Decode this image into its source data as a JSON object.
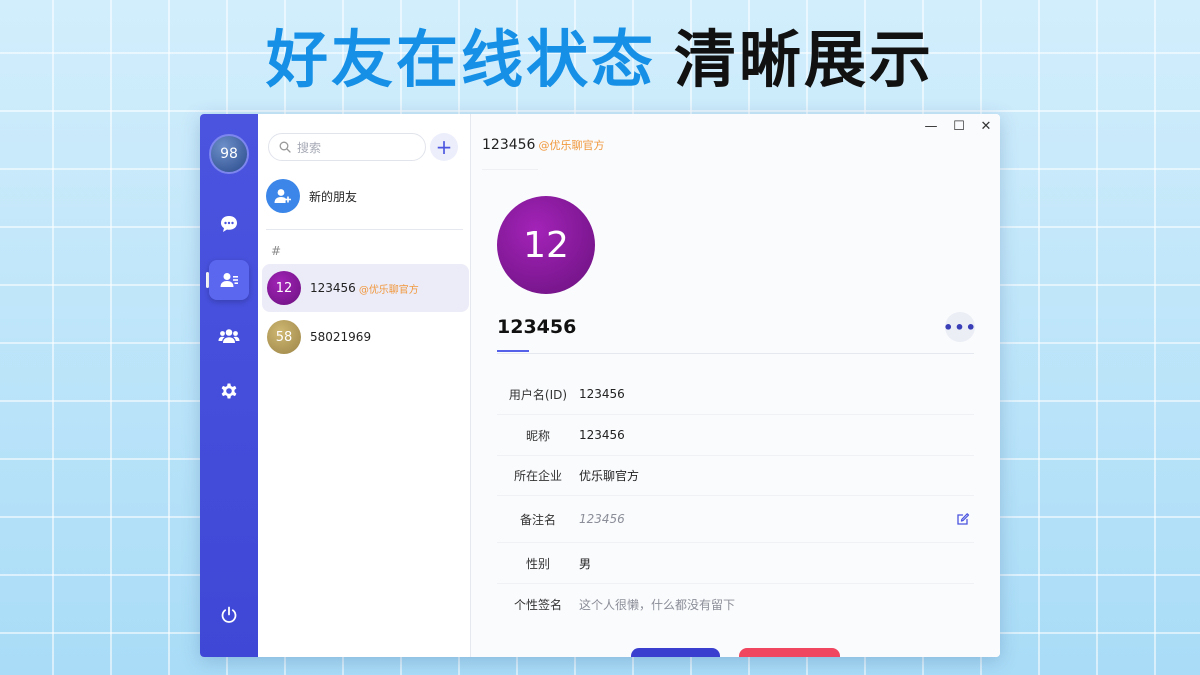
{
  "headline": {
    "part1": "好友在线状态",
    "part2": "清晰展示"
  },
  "rail": {
    "avatar_text": "98"
  },
  "contacts": {
    "search_placeholder": "搜索",
    "add_label": "+",
    "new_friend_label": "新的朋友",
    "group_letter": "#",
    "items": [
      {
        "avatar": "12",
        "name": "123456",
        "org": "@优乐聊官方",
        "color": "#8d1aa3",
        "selected": true
      },
      {
        "avatar": "58",
        "name": "58021969",
        "org": "",
        "color": "#b49b55",
        "selected": false
      }
    ]
  },
  "detail": {
    "title": "123456",
    "title_org": "@优乐聊官方",
    "avatar": "12",
    "name": "123456",
    "more": "•••",
    "window_controls": {
      "minimize": "—",
      "maximize": "☐",
      "close": "✕"
    },
    "fields": [
      {
        "label": "用户名(ID)",
        "value": "123456"
      },
      {
        "label": "昵称",
        "value": "123456"
      },
      {
        "label": "所在企业",
        "value": "优乐聊官方"
      },
      {
        "label": "备注名",
        "value": "123456"
      },
      {
        "label": "性别",
        "value": "男"
      },
      {
        "label": "个性签名",
        "value": "这个人很懒，什么都没有留下"
      }
    ]
  },
  "colors": {
    "accent": "#4a54df",
    "orange": "#f0993e",
    "danger": "#f0465f"
  }
}
